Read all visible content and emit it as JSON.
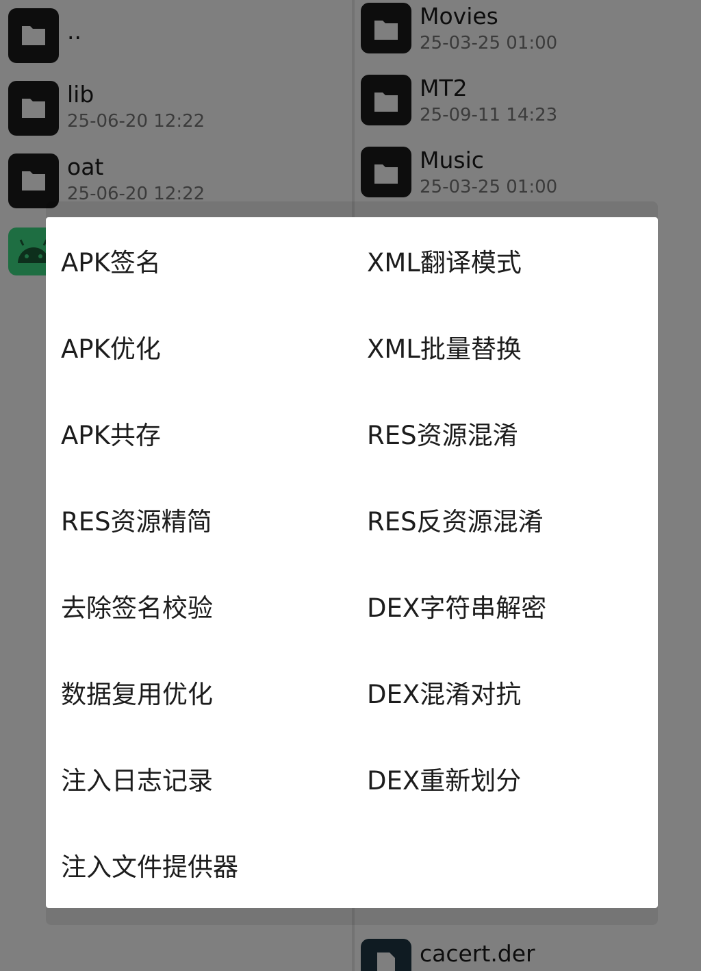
{
  "background": {
    "left_pane": {
      "items": [
        {
          "name": "..",
          "date": "",
          "icon": "folder-icon"
        },
        {
          "name": "lib",
          "date": "25-06-20 12:22",
          "icon": "folder-icon"
        },
        {
          "name": "oat",
          "date": "25-06-20 12:22",
          "icon": "folder-icon"
        },
        {
          "name": "",
          "date": "",
          "icon": "android-apk-icon"
        }
      ]
    },
    "right_pane": {
      "items": [
        {
          "name": "Movies",
          "date": "25-03-25 01:00",
          "icon": "folder-icon"
        },
        {
          "name": "MT2",
          "date": "25-09-11 14:23",
          "icon": "folder-icon"
        },
        {
          "name": "Music",
          "date": "25-03-25 01:00",
          "icon": "folder-icon"
        },
        {
          "name": "cacert.der",
          "date": "",
          "icon": "file-icon"
        }
      ]
    }
  },
  "dialog": {
    "menu": [
      "APK签名",
      "XML翻译模式",
      "APK优化",
      "XML批量替换",
      "APK共存",
      "RES资源混淆",
      "RES资源精简",
      "RES反资源混淆",
      "去除签名校验",
      "DEX字符串解密",
      "数据复用优化",
      "DEX混淆对抗",
      "注入日志记录",
      "DEX重新划分",
      "注入文件提供器"
    ]
  },
  "colors": {
    "scrim": "#000000",
    "dialog_bg": "#ffffff",
    "text": "#1c1c1c",
    "folder_tile": "#1a1a1a",
    "apk_tile": "#3ddc84"
  }
}
